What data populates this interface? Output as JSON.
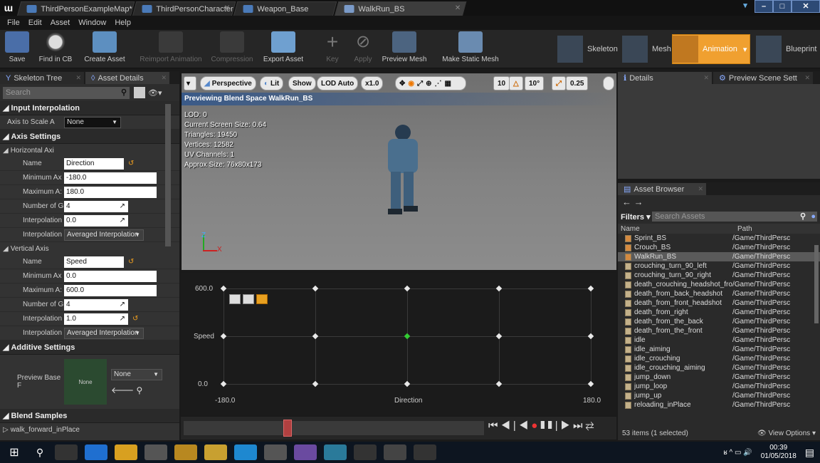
{
  "window": {
    "tabs": [
      {
        "label": "ThirdPersonExampleMap*"
      },
      {
        "label": "ThirdPersonCharacter"
      },
      {
        "label": "Weapon_Base"
      },
      {
        "label": "WalkRun_BS"
      }
    ],
    "controls": {
      "minimize": "–",
      "maximize": "□",
      "close": "✕"
    }
  },
  "menu": [
    "File",
    "Edit",
    "Asset",
    "Window",
    "Help"
  ],
  "toolbar": {
    "buttons": [
      {
        "label": "Save"
      },
      {
        "label": "Find in CB"
      },
      {
        "label": "Create Asset"
      },
      {
        "label": "Reimport Animation"
      },
      {
        "label": "Compression"
      },
      {
        "label": "Export Asset"
      },
      {
        "label": "Key"
      },
      {
        "label": "Apply"
      },
      {
        "label": "Preview Mesh"
      },
      {
        "label": "Make Static Mesh"
      }
    ],
    "modes": [
      {
        "label": "Skeleton"
      },
      {
        "label": "Mesh"
      },
      {
        "label": "Animation"
      },
      {
        "label": "Blueprint"
      }
    ]
  },
  "left_panel": {
    "tabs": [
      "Skeleton Tree",
      "Asset Details"
    ],
    "search_placeholder": "Search",
    "input_interpolation": {
      "title": "Input Interpolation",
      "axis_to_scale_label": "Axis to Scale A",
      "axis_to_scale_value": "None"
    },
    "axis_settings": {
      "title": "Axis Settings",
      "horizontal": {
        "title": "Horizontal Axi",
        "name_label": "Name",
        "name_value": "Direction",
        "min_label": "Minimum Ax",
        "min_value": "-180.0",
        "max_label": "Maximum A:",
        "max_value": "180.0",
        "grid_label": "Number of Gr",
        "grid_value": "4",
        "interp_label": "Interpolation",
        "interp_value": "0.0",
        "interp_type_label": "Interpolation",
        "interp_type_value": "Averaged Interpolation"
      },
      "vertical": {
        "title": "Vertical Axis",
        "name_label": "Name",
        "name_value": "Speed",
        "min_label": "Minimum Ax",
        "min_value": "0.0",
        "max_label": "Maximum A:",
        "max_value": "600.0",
        "grid_label": "Number of Gr",
        "grid_value": "4",
        "interp_label": "Interpolation",
        "interp_value": "1.0",
        "interp_type_label": "Interpolation",
        "interp_type_value": "Averaged Interpolation"
      }
    },
    "additive": {
      "title": "Additive Settings",
      "preview_label": "Preview Base F",
      "thumb_label": "None",
      "dropdown_value": "None"
    },
    "blend_samples": {
      "title": "Blend Samples",
      "item": "walk_forward_inPlace"
    }
  },
  "viewport": {
    "buttons": {
      "perspective": "Perspective",
      "lit": "Lit",
      "show": "Show",
      "lod": "LOD Auto",
      "speed": "x1.0",
      "grid": "10",
      "angle": "10°",
      "scale": "0.25"
    },
    "banner": "Previewing Blend Space WalkRun_BS",
    "stats": [
      "LOD: 0",
      "Current Screen Size: 0.64",
      "Triangles: 19450",
      "Vertices: 12582",
      "UV Channels: 1",
      "Approx Size: 76x80x173"
    ],
    "axis_z": "Z",
    "axis_x": "X"
  },
  "blend_graph": {
    "y_max": "600.0",
    "y_label": "Speed",
    "y_min": "0.0",
    "x_min": "-180.0",
    "x_label": "Direction",
    "x_max": "180.0"
  },
  "details_panel": {
    "tabs": [
      "Details",
      "Preview Scene Sett"
    ]
  },
  "asset_browser": {
    "tab": "Asset Browser",
    "filters": "Filters",
    "search_placeholder": "Search Assets",
    "col_name": "Name",
    "col_path": "Path",
    "items": [
      {
        "name": "Sprint_BS",
        "path": "/Game/ThirdPersc"
      },
      {
        "name": "Crouch_BS",
        "path": "/Game/ThirdPersc"
      },
      {
        "name": "WalkRun_BS",
        "path": "/Game/ThirdPersc"
      },
      {
        "name": "crouching_turn_90_left",
        "path": "/Game/ThirdPersc"
      },
      {
        "name": "crouching_turn_90_right",
        "path": "/Game/ThirdPersc"
      },
      {
        "name": "death_crouching_headshot_front",
        "path": "/Game/ThirdPersc"
      },
      {
        "name": "death_from_back_headshot",
        "path": "/Game/ThirdPersc"
      },
      {
        "name": "death_from_front_headshot",
        "path": "/Game/ThirdPersc"
      },
      {
        "name": "death_from_right",
        "path": "/Game/ThirdPersc"
      },
      {
        "name": "death_from_the_back",
        "path": "/Game/ThirdPersc"
      },
      {
        "name": "death_from_the_front",
        "path": "/Game/ThirdPersc"
      },
      {
        "name": "idle",
        "path": "/Game/ThirdPersc"
      },
      {
        "name": "idle_aiming",
        "path": "/Game/ThirdPersc"
      },
      {
        "name": "idle_crouching",
        "path": "/Game/ThirdPersc"
      },
      {
        "name": "idle_crouching_aiming",
        "path": "/Game/ThirdPersc"
      },
      {
        "name": "jump_down",
        "path": "/Game/ThirdPersc"
      },
      {
        "name": "jump_loop",
        "path": "/Game/ThirdPersc"
      },
      {
        "name": "jump_up",
        "path": "/Game/ThirdPersc"
      },
      {
        "name": "reloading_inPlace",
        "path": "/Game/ThirdPersc"
      }
    ],
    "count": "53 items (1 selected)",
    "view_options": "View Options"
  },
  "taskbar": {
    "time": "00:39",
    "date": "01/05/2018"
  }
}
